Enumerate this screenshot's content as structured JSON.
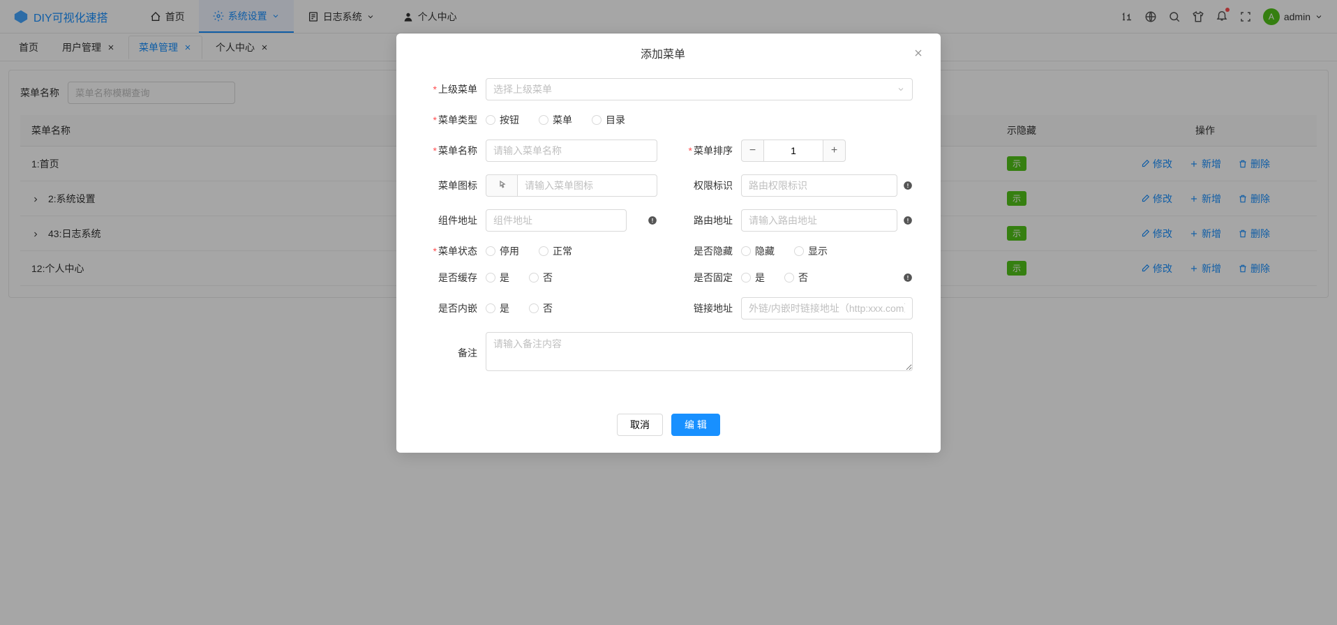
{
  "logo": "DIY可视化速搭",
  "nav": [
    {
      "label": "首页"
    },
    {
      "label": "系统设置",
      "active": true,
      "dropdown": true
    },
    {
      "label": "日志系统",
      "dropdown": true
    },
    {
      "label": "个人中心"
    }
  ],
  "user": {
    "initial": "A",
    "name": "admin"
  },
  "tabs": [
    {
      "label": "首页"
    },
    {
      "label": "用户管理",
      "closable": true
    },
    {
      "label": "菜单管理",
      "closable": true,
      "active": true
    },
    {
      "label": "个人中心",
      "closable": true
    }
  ],
  "search": {
    "label": "菜单名称",
    "placeholder": "菜单名称模糊查询"
  },
  "table": {
    "headers": {
      "name": "菜单名称",
      "hide": "示隐藏",
      "action": "操作"
    },
    "rows": [
      {
        "id": "1",
        "name": "首页",
        "badgePartial": "示"
      },
      {
        "id": "2",
        "name": "系统设置",
        "expandable": true,
        "badgePartial": "示"
      },
      {
        "id": "43",
        "name": "日志系统",
        "expandable": true,
        "badgePartial": "示"
      },
      {
        "id": "12",
        "name": "个人中心",
        "badgePartial": "示"
      }
    ],
    "actions": {
      "edit": "修改",
      "add": "新增",
      "delete": "删除"
    }
  },
  "modal": {
    "title": "添加菜单",
    "parentMenu": {
      "label": "上级菜单",
      "placeholder": "选择上级菜单"
    },
    "menuType": {
      "label": "菜单类型",
      "options": [
        "按钮",
        "菜单",
        "目录"
      ]
    },
    "menuName": {
      "label": "菜单名称",
      "placeholder": "请输入菜单名称"
    },
    "menuSort": {
      "label": "菜单排序",
      "value": "1"
    },
    "menuIcon": {
      "label": "菜单图标",
      "placeholder": "请输入菜单图标"
    },
    "permission": {
      "label": "权限标识",
      "placeholder": "路由权限标识"
    },
    "componentPath": {
      "label": "组件地址",
      "placeholder": "组件地址"
    },
    "routePath": {
      "label": "路由地址",
      "placeholder": "请输入路由地址"
    },
    "menuStatus": {
      "label": "菜单状态",
      "options": [
        "停用",
        "正常"
      ]
    },
    "isHidden": {
      "label": "是否隐藏",
      "options": [
        "隐藏",
        "显示"
      ]
    },
    "isCache": {
      "label": "是否缓存",
      "options": [
        "是",
        "否"
      ]
    },
    "isFixed": {
      "label": "是否固定",
      "options": [
        "是",
        "否"
      ]
    },
    "isEmbed": {
      "label": "是否内嵌",
      "options": [
        "是",
        "否"
      ]
    },
    "linkUrl": {
      "label": "链接地址",
      "placeholder": "外链/内嵌时链接地址（http:xxx.com）"
    },
    "remark": {
      "label": "备注",
      "placeholder": "请输入备注内容"
    },
    "cancel": "取消",
    "submit": "编 辑"
  }
}
